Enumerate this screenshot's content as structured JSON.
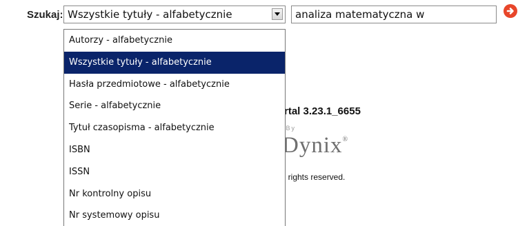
{
  "search": {
    "label": "Szukaj:",
    "selected_index": "Wszystkie tytuły - alfabetycznie",
    "query_value": "analiza matematyczna w",
    "options": [
      "Autorzy - alfabetycznie",
      "Wszystkie tytuły - alfabetycznie",
      "Hasła przedmiotowe - alfabetycznie",
      "Serie - alfabetycznie",
      "Tytuł czasopisma - alfabetycznie",
      "ISBN",
      "ISSN",
      "Nr kontrolny opisu",
      "Nr systemowy opisu"
    ],
    "highlighted_option": "Wszystkie tytuły - alfabetycznie"
  },
  "footer": {
    "version_text": "rtal 3.23.1_6655",
    "powered_by": "d By",
    "logo_text": "Dynix",
    "logo_mark": "®",
    "rights_text": "ll rights reserved."
  },
  "icons": {
    "dropdown_arrow": "chevron-down-icon",
    "go": "go-arrow-icon"
  },
  "colors": {
    "highlight": "#0a246a",
    "go_icon": "#e8462a"
  }
}
